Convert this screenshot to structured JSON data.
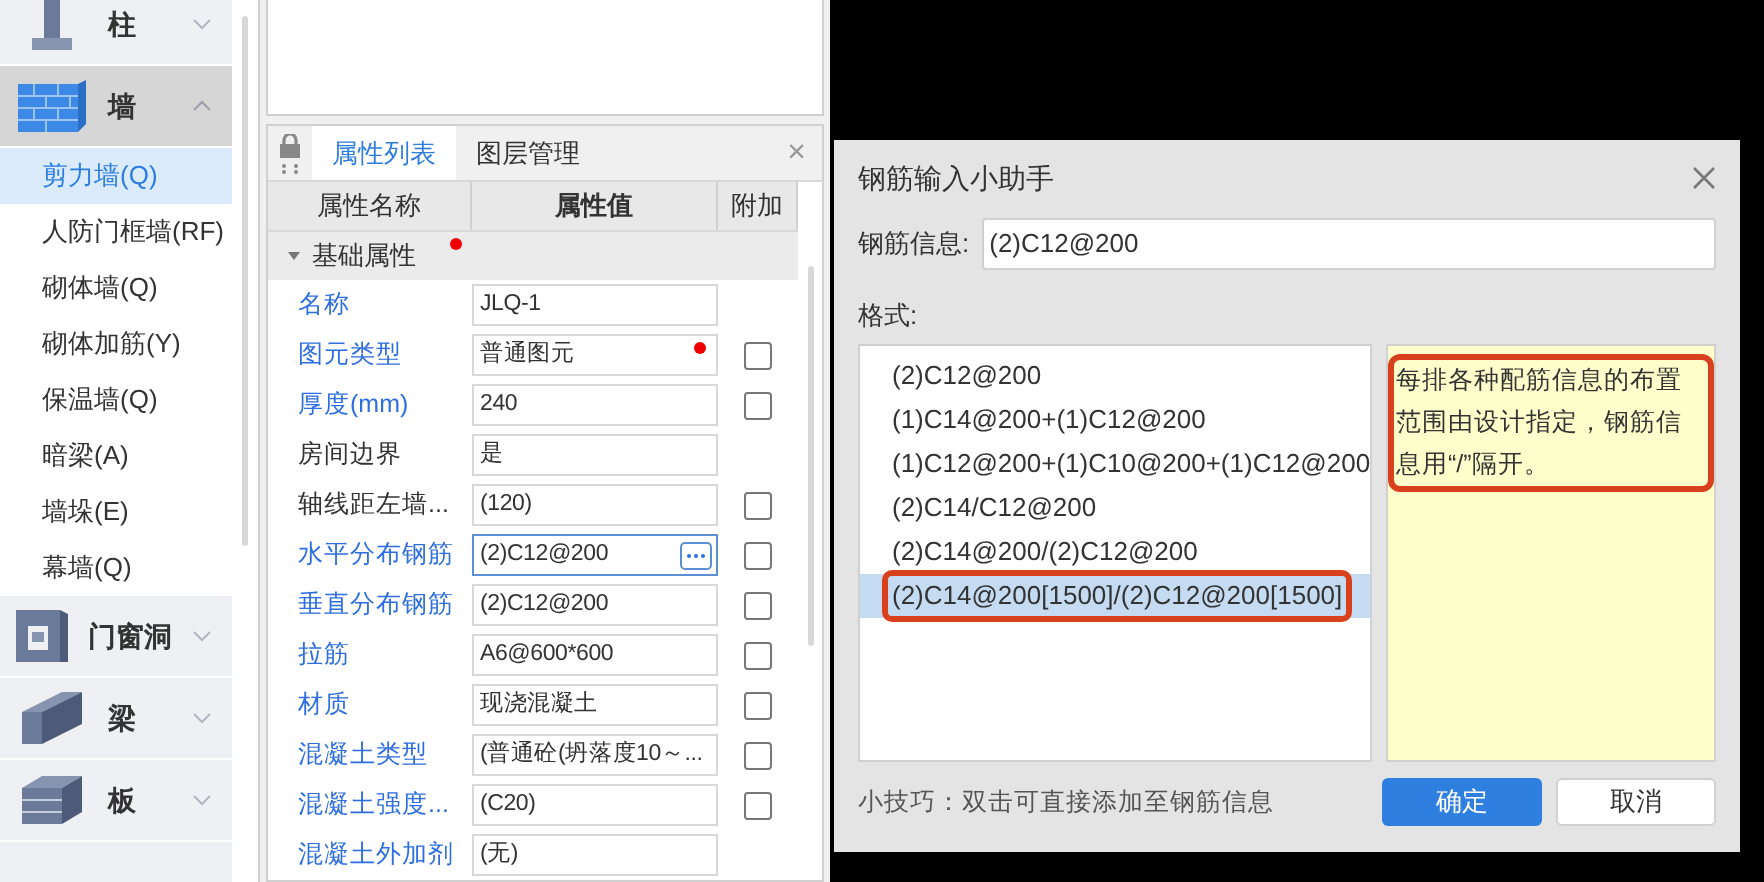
{
  "sidebar": {
    "categories": [
      {
        "label": "柱",
        "expanded": false,
        "selected": false
      },
      {
        "label": "墙",
        "expanded": true,
        "selected": true,
        "children": [
          {
            "label": "剪力墙(Q)",
            "selected": true
          },
          {
            "label": "人防门框墙(RF)",
            "selected": false
          },
          {
            "label": "砌体墙(Q)",
            "selected": false
          },
          {
            "label": "砌体加筋(Y)",
            "selected": false
          },
          {
            "label": "保温墙(Q)",
            "selected": false
          },
          {
            "label": "暗梁(A)",
            "selected": false
          },
          {
            "label": "墙垛(E)",
            "selected": false
          },
          {
            "label": "幕墙(Q)",
            "selected": false
          }
        ]
      },
      {
        "label": "门窗洞",
        "expanded": false,
        "selected": false
      },
      {
        "label": "梁",
        "expanded": false,
        "selected": false
      },
      {
        "label": "板",
        "expanded": false,
        "selected": false
      }
    ]
  },
  "properties": {
    "tabs": [
      {
        "label": "属性列表",
        "selected": true
      },
      {
        "label": "图层管理",
        "selected": false
      }
    ],
    "close": "×",
    "columns": [
      "属性名称",
      "属性值",
      "附加"
    ],
    "group": {
      "label": "基础属性",
      "expanded": true,
      "marked": true
    },
    "rows": [
      {
        "name": "名称",
        "value": "JLQ-1",
        "link": true,
        "checkbox": false,
        "marked": false,
        "active": false
      },
      {
        "name": "图元类型",
        "value": "普通图元",
        "link": true,
        "checkbox": true,
        "checked": false,
        "marked": true,
        "active": false
      },
      {
        "name": "厚度(mm)",
        "value": "240",
        "link": true,
        "checkbox": true,
        "checked": false,
        "marked": false,
        "active": false
      },
      {
        "name": "房间边界",
        "value": "是",
        "link": false,
        "checkbox": false,
        "marked": false,
        "active": false
      },
      {
        "name": "轴线距左墙...",
        "value": "(120)",
        "link": false,
        "checkbox": true,
        "checked": false,
        "marked": false,
        "active": false
      },
      {
        "name": "水平分布钢筋",
        "value": "(2)C12@200",
        "link": true,
        "checkbox": true,
        "checked": false,
        "marked": false,
        "active": true
      },
      {
        "name": "垂直分布钢筋",
        "value": "(2)C12@200",
        "link": true,
        "checkbox": true,
        "checked": false,
        "marked": false,
        "active": false
      },
      {
        "name": "拉筋",
        "value": "A6@600*600",
        "link": true,
        "checkbox": true,
        "checked": false,
        "marked": false,
        "active": false
      },
      {
        "name": "材质",
        "value": "现浇混凝土",
        "link": true,
        "checkbox": true,
        "checked": false,
        "marked": false,
        "active": false
      },
      {
        "name": "混凝土类型",
        "value": "(普通砼(坍落度10～...",
        "link": true,
        "checkbox": true,
        "checked": false,
        "marked": false,
        "active": false
      },
      {
        "name": "混凝土强度...",
        "value": "(C20)",
        "link": true,
        "checkbox": true,
        "checked": false,
        "marked": false,
        "active": false
      },
      {
        "name": "混凝土外加剂",
        "value": "(无)",
        "link": true,
        "checkbox": false,
        "marked": false,
        "active": false
      }
    ]
  },
  "dialog": {
    "title": "钢筋输入小助手",
    "input_label": "钢筋信息:",
    "input_value": "(2)C12@200",
    "format_label": "格式:",
    "formats": [
      {
        "label": "(2)C12@200",
        "selected": false,
        "highlighted": false
      },
      {
        "label": "(1)C14@200+(1)C12@200",
        "selected": false,
        "highlighted": false
      },
      {
        "label": "(1)C12@200+(1)C10@200+(1)C12@200",
        "selected": false,
        "highlighted": false
      },
      {
        "label": "(2)C14/C12@200",
        "selected": false,
        "highlighted": false
      },
      {
        "label": "(2)C14@200/(2)C12@200",
        "selected": false,
        "highlighted": false
      },
      {
        "label": "(2)C14@200[1500]/(2)C12@200[1500]",
        "selected": true,
        "highlighted": true
      }
    ],
    "note": {
      "text": "每排各种配筋信息的布置范围由设计指定，钢筋信息用“/”隔开。",
      "highlighted": true
    },
    "tip": "小技巧：双击可直接添加至钢筋信息",
    "buttons": [
      {
        "label": "确定",
        "primary": true
      },
      {
        "label": "取消",
        "primary": false
      }
    ]
  }
}
